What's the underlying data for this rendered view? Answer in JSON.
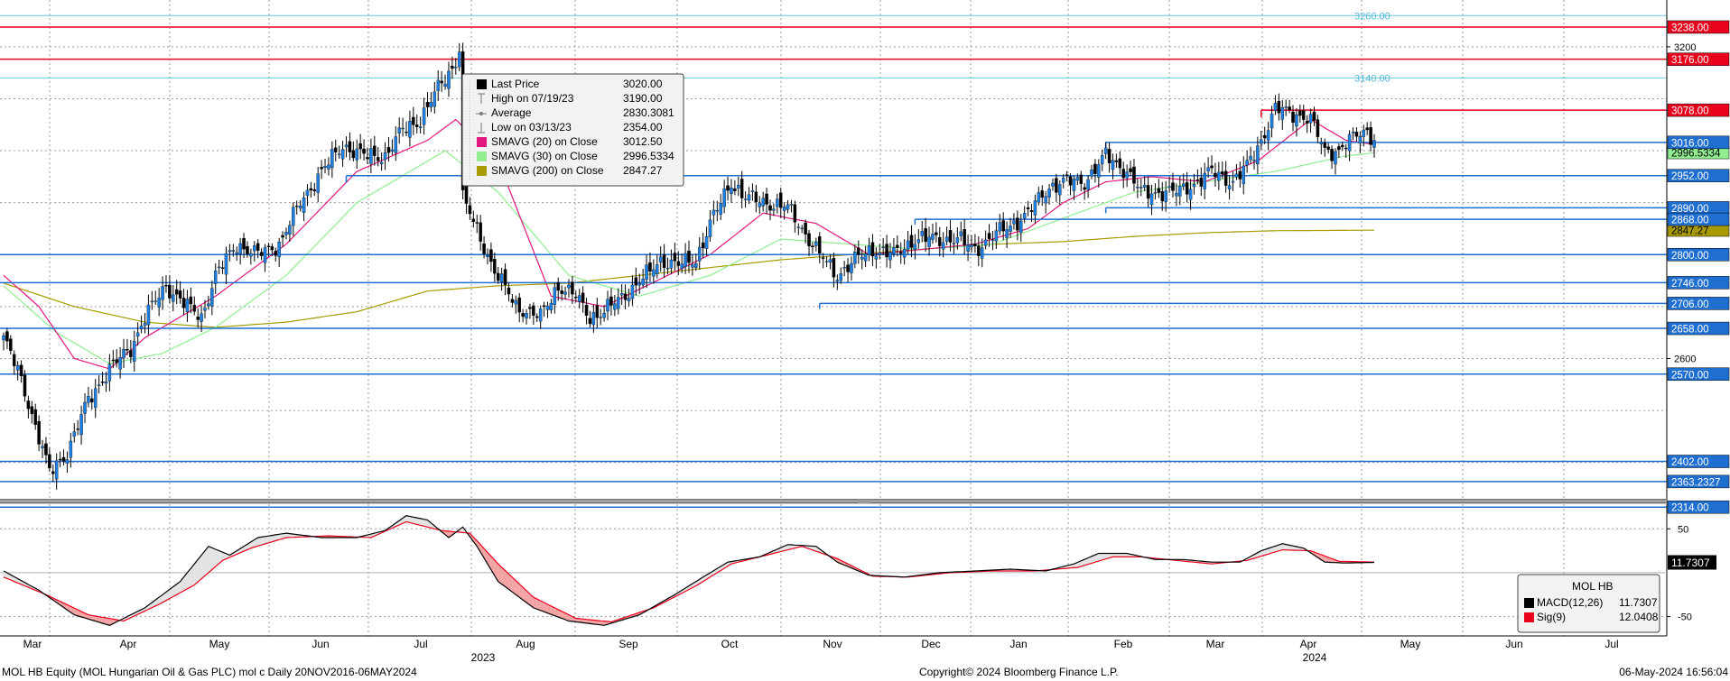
{
  "chart_data": {
    "type": "candlestick",
    "security": "MOL HB Equity (MOL Hungarian Oil & Gas PLC) mol c  Daily 20NOV2016-06MAY2024",
    "copyright": "Copyright© 2024 Bloomberg Finance L.P.",
    "timestamp": "06-May-2024 16:56:04",
    "x_months": [
      "Mar",
      "Apr",
      "May",
      "Jun",
      "Jul",
      "Aug",
      "Sep",
      "Oct",
      "Nov",
      "Dec",
      "Jan",
      "Feb",
      "Mar",
      "Apr",
      "May",
      "Jun",
      "Jul"
    ],
    "x_years": [
      "2023",
      "2024"
    ],
    "price_ylim": [
      2330,
      3290
    ],
    "price_ticks": [
      "3200",
      "2600"
    ],
    "price_levels": [
      {
        "value": 3238.0,
        "label": "3238.00",
        "color": "#e8001c",
        "from": "start"
      },
      {
        "value": 3176.0,
        "label": "3176.00",
        "color": "#e8001c",
        "from": "start"
      },
      {
        "value": 3078.0,
        "label": "3078.00",
        "color": "#e8001c",
        "from": "Mar 2024"
      },
      {
        "value": 3016.0,
        "label": "3016.00",
        "color": "#1f6fd1",
        "from": "Feb 2024"
      },
      {
        "value": 2952.0,
        "label": "2952.00",
        "color": "#1f6fd1",
        "from": "Jun 2023"
      },
      {
        "value": 2890.0,
        "label": "2890.00",
        "color": "#1f6fd1",
        "from": "Feb 2024"
      },
      {
        "value": 2868.0,
        "label": "2868.00",
        "color": "#1f6fd1",
        "from": "Dec 2023"
      },
      {
        "value": 2800.0,
        "label": "2800.00",
        "color": "#1f6fd1",
        "from": "start"
      },
      {
        "value": 2746.0,
        "label": "2746.00",
        "color": "#1f6fd1",
        "from": "start"
      },
      {
        "value": 2706.0,
        "label": "2706.00",
        "color": "#1f6fd1",
        "from": "Nov 2023"
      },
      {
        "value": 2658.0,
        "label": "2658.00",
        "color": "#1f6fd1",
        "from": "start"
      },
      {
        "value": 2570.0,
        "label": "2570.00",
        "color": "#1f6fd1",
        "from": "start"
      },
      {
        "value": 2402.0,
        "label": "2402.00",
        "color": "#1f6fd1",
        "from": "start"
      },
      {
        "value": 2363.2327,
        "label": "2363.2327",
        "color": "#1f6fd1",
        "from": "start"
      },
      {
        "value": 2314.0,
        "label": "2314.00",
        "color": "#1f6fd1",
        "from": "start"
      }
    ],
    "fib_levels": [
      {
        "value": 3260,
        "label": "3260.00"
      },
      {
        "value": 3140,
        "label": "3140.00"
      }
    ],
    "axis_value_tags": [
      {
        "value": 2996.5334,
        "label": "2996.5334",
        "color": "#90ee90"
      },
      {
        "value": 2847.27,
        "label": "2847.27",
        "color": "#a89a00"
      }
    ],
    "legend": [
      {
        "icon": "square",
        "color": "#000000",
        "label": "Last Price",
        "value": "3020.00"
      },
      {
        "icon": "high",
        "color": "#808080",
        "label": "High on 07/19/23",
        "value": "3190.00"
      },
      {
        "icon": "avg",
        "color": "#808080",
        "label": "Average",
        "value": "2830.3081"
      },
      {
        "icon": "low",
        "color": "#808080",
        "label": "Low on 03/13/23",
        "value": "2354.00"
      },
      {
        "icon": "square",
        "color": "#e2187f",
        "label": "SMAVG (20)  on Close",
        "value": "3012.50"
      },
      {
        "icon": "square",
        "color": "#90ee90",
        "label": "SMAVG (30)  on Close",
        "value": "2996.5334"
      },
      {
        "icon": "square",
        "color": "#a89a00",
        "label": "SMAVG (200)  on Close",
        "value": "2847.27"
      }
    ],
    "close_anchors": [
      [
        0,
        2640
      ],
      [
        5,
        2560
      ],
      [
        9,
        2470
      ],
      [
        13,
        2380
      ],
      [
        18,
        2420
      ],
      [
        24,
        2520
      ],
      [
        30,
        2580
      ],
      [
        36,
        2620
      ],
      [
        40,
        2680
      ],
      [
        46,
        2740
      ],
      [
        52,
        2700
      ],
      [
        56,
        2680
      ],
      [
        60,
        2760
      ],
      [
        66,
        2820
      ],
      [
        72,
        2800
      ],
      [
        78,
        2820
      ],
      [
        84,
        2900
      ],
      [
        90,
        2960
      ],
      [
        96,
        3010
      ],
      [
        102,
        2990
      ],
      [
        108,
        2990
      ],
      [
        113,
        3040
      ],
      [
        118,
        3060
      ],
      [
        123,
        3120
      ],
      [
        128,
        3170
      ],
      [
        129,
        3190
      ],
      [
        130,
        2910
      ],
      [
        135,
        2830
      ],
      [
        139,
        2770
      ],
      [
        145,
        2700
      ],
      [
        152,
        2680
      ],
      [
        157,
        2740
      ],
      [
        162,
        2720
      ],
      [
        166,
        2680
      ],
      [
        170,
        2690
      ],
      [
        177,
        2730
      ],
      [
        182,
        2760
      ],
      [
        186,
        2790
      ],
      [
        191,
        2780
      ],
      [
        196,
        2790
      ],
      [
        200,
        2860
      ],
      [
        206,
        2940
      ],
      [
        210,
        2910
      ],
      [
        216,
        2900
      ],
      [
        222,
        2890
      ],
      [
        227,
        2840
      ],
      [
        231,
        2800
      ],
      [
        236,
        2760
      ],
      [
        241,
        2790
      ],
      [
        246,
        2810
      ],
      [
        252,
        2800
      ],
      [
        258,
        2830
      ],
      [
        263,
        2830
      ],
      [
        270,
        2830
      ],
      [
        275,
        2810
      ],
      [
        281,
        2840
      ],
      [
        286,
        2860
      ],
      [
        290,
        2880
      ],
      [
        296,
        2930
      ],
      [
        300,
        2940
      ],
      [
        306,
        2940
      ],
      [
        312,
        2990
      ],
      [
        318,
        2960
      ],
      [
        322,
        2920
      ],
      [
        327,
        2920
      ],
      [
        332,
        2920
      ],
      [
        338,
        2940
      ],
      [
        342,
        2960
      ],
      [
        348,
        2940
      ],
      [
        352,
        2970
      ],
      [
        356,
        3020
      ],
      [
        360,
        3080
      ],
      [
        366,
        3070
      ],
      [
        370,
        3060
      ],
      [
        374,
        3000
      ],
      [
        378,
        3000
      ],
      [
        383,
        3030
      ],
      [
        386,
        3040
      ],
      [
        388,
        3020
      ]
    ],
    "sma20_anchors": [
      [
        0,
        2760
      ],
      [
        10,
        2700
      ],
      [
        20,
        2600
      ],
      [
        30,
        2580
      ],
      [
        40,
        2640
      ],
      [
        60,
        2720
      ],
      [
        80,
        2820
      ],
      [
        100,
        2960
      ],
      [
        120,
        3020
      ],
      [
        128,
        3060
      ],
      [
        140,
        2980
      ],
      [
        155,
        2720
      ],
      [
        170,
        2700
      ],
      [
        185,
        2750
      ],
      [
        200,
        2800
      ],
      [
        215,
        2880
      ],
      [
        230,
        2860
      ],
      [
        245,
        2800
      ],
      [
        260,
        2810
      ],
      [
        275,
        2820
      ],
      [
        290,
        2850
      ],
      [
        300,
        2900
      ],
      [
        312,
        2940
      ],
      [
        325,
        2950
      ],
      [
        340,
        2940
      ],
      [
        355,
        2980
      ],
      [
        370,
        3060
      ],
      [
        380,
        3020
      ],
      [
        388,
        3012
      ]
    ],
    "sma30_anchors": [
      [
        0,
        2740
      ],
      [
        15,
        2650
      ],
      [
        30,
        2590
      ],
      [
        45,
        2610
      ],
      [
        60,
        2660
      ],
      [
        80,
        2760
      ],
      [
        100,
        2900
      ],
      [
        115,
        2960
      ],
      [
        125,
        3000
      ],
      [
        140,
        2920
      ],
      [
        160,
        2760
      ],
      [
        180,
        2720
      ],
      [
        200,
        2760
      ],
      [
        220,
        2830
      ],
      [
        240,
        2820
      ],
      [
        260,
        2810
      ],
      [
        280,
        2820
      ],
      [
        300,
        2870
      ],
      [
        320,
        2920
      ],
      [
        340,
        2940
      ],
      [
        360,
        2960
      ],
      [
        380,
        2990
      ],
      [
        388,
        2996
      ]
    ],
    "sma200_anchors": [
      [
        0,
        2745
      ],
      [
        20,
        2700
      ],
      [
        40,
        2670
      ],
      [
        60,
        2660
      ],
      [
        80,
        2670
      ],
      [
        100,
        2690
      ],
      [
        120,
        2730
      ],
      [
        140,
        2740
      ],
      [
        160,
        2745
      ],
      [
        180,
        2760
      ],
      [
        200,
        2775
      ],
      [
        220,
        2790
      ],
      [
        240,
        2800
      ],
      [
        260,
        2810
      ],
      [
        280,
        2820
      ],
      [
        300,
        2825
      ],
      [
        320,
        2835
      ],
      [
        340,
        2842
      ],
      [
        360,
        2846
      ],
      [
        388,
        2847
      ]
    ],
    "macd_ylim": [
      -72,
      78
    ],
    "macd_ticks": [
      "50",
      "-50"
    ],
    "macd_last_label": "11.7307",
    "macd_anchors": [
      [
        0,
        2
      ],
      [
        10,
        -20
      ],
      [
        20,
        -48
      ],
      [
        30,
        -60
      ],
      [
        40,
        -40
      ],
      [
        50,
        -10
      ],
      [
        58,
        30
      ],
      [
        64,
        20
      ],
      [
        72,
        40
      ],
      [
        80,
        45
      ],
      [
        90,
        40
      ],
      [
        100,
        40
      ],
      [
        108,
        48
      ],
      [
        114,
        65
      ],
      [
        120,
        60
      ],
      [
        126,
        40
      ],
      [
        130,
        52
      ],
      [
        134,
        30
      ],
      [
        140,
        -10
      ],
      [
        150,
        -40
      ],
      [
        160,
        -55
      ],
      [
        170,
        -60
      ],
      [
        180,
        -48
      ],
      [
        190,
        -25
      ],
      [
        198,
        -5
      ],
      [
        205,
        12
      ],
      [
        214,
        18
      ],
      [
        222,
        32
      ],
      [
        230,
        30
      ],
      [
        236,
        12
      ],
      [
        245,
        -3
      ],
      [
        255,
        -5
      ],
      [
        265,
        0
      ],
      [
        275,
        2
      ],
      [
        285,
        4
      ],
      [
        295,
        2
      ],
      [
        303,
        10
      ],
      [
        310,
        22
      ],
      [
        318,
        22
      ],
      [
        326,
        15
      ],
      [
        334,
        15
      ],
      [
        342,
        12
      ],
      [
        350,
        12
      ],
      [
        356,
        25
      ],
      [
        362,
        33
      ],
      [
        368,
        28
      ],
      [
        374,
        12
      ],
      [
        380,
        11
      ],
      [
        388,
        11.73
      ]
    ],
    "sig_anchors": [
      [
        0,
        -5
      ],
      [
        12,
        -25
      ],
      [
        24,
        -48
      ],
      [
        34,
        -55
      ],
      [
        44,
        -36
      ],
      [
        54,
        -14
      ],
      [
        62,
        14
      ],
      [
        70,
        28
      ],
      [
        80,
        40
      ],
      [
        92,
        42
      ],
      [
        104,
        40
      ],
      [
        114,
        58
      ],
      [
        124,
        48
      ],
      [
        132,
        45
      ],
      [
        140,
        10
      ],
      [
        150,
        -28
      ],
      [
        162,
        -52
      ],
      [
        172,
        -56
      ],
      [
        184,
        -40
      ],
      [
        196,
        -15
      ],
      [
        206,
        10
      ],
      [
        216,
        20
      ],
      [
        226,
        30
      ],
      [
        236,
        16
      ],
      [
        246,
        -4
      ],
      [
        256,
        -5
      ],
      [
        268,
        0
      ],
      [
        280,
        2
      ],
      [
        292,
        2
      ],
      [
        304,
        6
      ],
      [
        314,
        18
      ],
      [
        322,
        18
      ],
      [
        332,
        14
      ],
      [
        342,
        10
      ],
      [
        352,
        14
      ],
      [
        362,
        26
      ],
      [
        370,
        25
      ],
      [
        378,
        13
      ],
      [
        388,
        12.04
      ]
    ],
    "macd_legend": {
      "title": "MOL HB",
      "items": [
        {
          "color": "#000000",
          "label": "MACD(12,26)",
          "value": "11.7307"
        },
        {
          "color": "#e8001c",
          "label": "Sig(9)",
          "value": "12.0408"
        }
      ]
    }
  }
}
